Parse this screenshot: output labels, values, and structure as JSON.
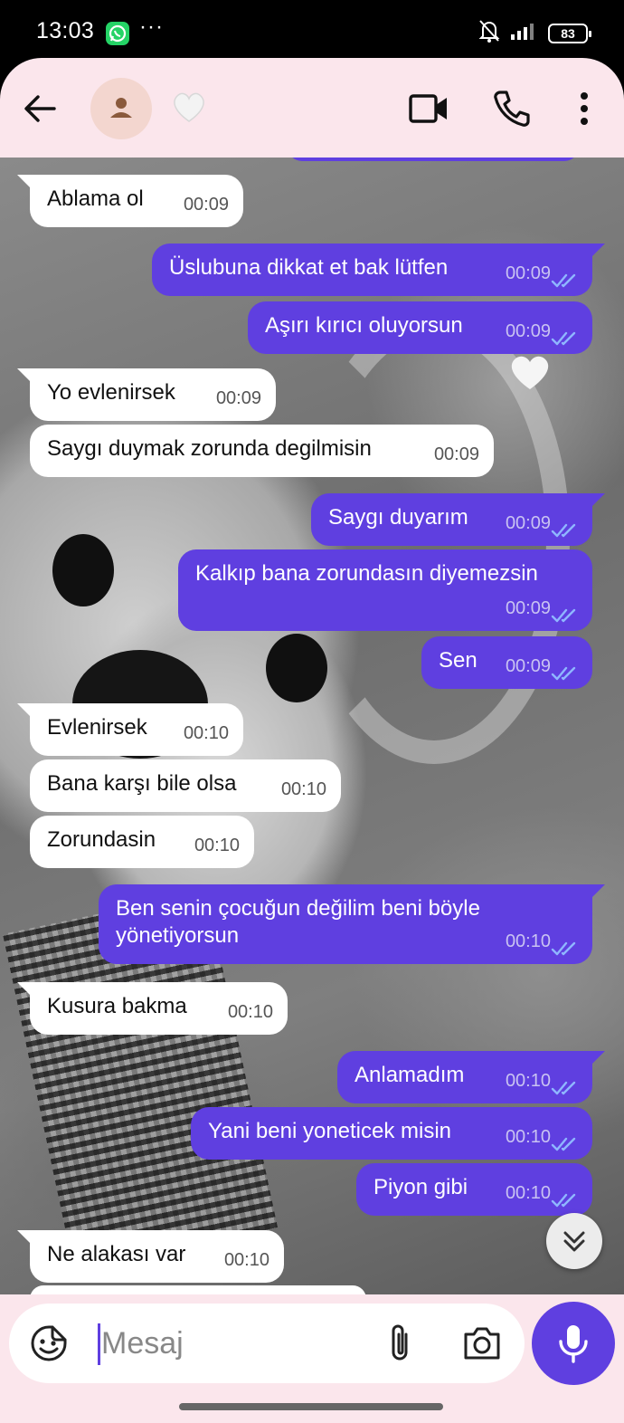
{
  "status_bar": {
    "time": "13:03",
    "battery": "83",
    "icons": [
      "whatsapp-icon",
      "more-dots-icon",
      "mute-bell-icon",
      "signal-icon",
      "battery-icon"
    ]
  },
  "header": {
    "contact_emoji": "heart-emoji",
    "actions": [
      "back-arrow-icon",
      "avatar-icon",
      "video-call-icon",
      "phone-icon",
      "more-vertical-icon"
    ]
  },
  "messages": [
    {
      "dir": "in",
      "text": "Ablama ol",
      "time": "00:09"
    },
    {
      "dir": "out",
      "text": "Üslubuna dikkat et bak lütfen",
      "time": "00:09"
    },
    {
      "dir": "out",
      "text": "Aşırı kırıcı oluyorsun",
      "time": "00:09"
    },
    {
      "dir": "in",
      "text": "Yo evlenirsek",
      "time": "00:09"
    },
    {
      "dir": "in",
      "text": "Saygı duymak zorunda degilmisin",
      "time": "00:09"
    },
    {
      "dir": "out",
      "text": "Saygı duyarım",
      "time": "00:09"
    },
    {
      "dir": "out",
      "text": "Kalkıp bana zorundasın diyemezsin",
      "time": "00:09"
    },
    {
      "dir": "out",
      "text": "Sen",
      "time": "00:09"
    },
    {
      "dir": "in",
      "text": "Evlenirsek",
      "time": "00:10"
    },
    {
      "dir": "in",
      "text": "Bana karşı bile olsa",
      "time": "00:10"
    },
    {
      "dir": "in",
      "text": "Zorundasin",
      "time": "00:10"
    },
    {
      "dir": "out",
      "text": "Ben senin çocuğun değilim beni böyle yönetiyorsun",
      "time": "00:10"
    },
    {
      "dir": "in",
      "text": "Kusura bakma",
      "time": "00:10"
    },
    {
      "dir": "out",
      "text": "Anlamadım",
      "time": "00:10"
    },
    {
      "dir": "out",
      "text": "Yani beni yoneticek misin",
      "time": "00:10"
    },
    {
      "dir": "out",
      "text": "Piyon gibi",
      "time": "00:10"
    },
    {
      "dir": "in",
      "text": "Ne alakası var",
      "time": "00:10"
    }
  ],
  "composer": {
    "placeholder": "Mesaj",
    "icons": [
      "sticker-emoji-icon",
      "paperclip-icon",
      "camera-icon",
      "microphone-icon"
    ]
  },
  "colors": {
    "outgoing_bubble": "#5f3fe0",
    "incoming_bubble": "#ffffff",
    "header_bg": "#fbe6ec",
    "read_ticks": "#8fb6ff"
  }
}
